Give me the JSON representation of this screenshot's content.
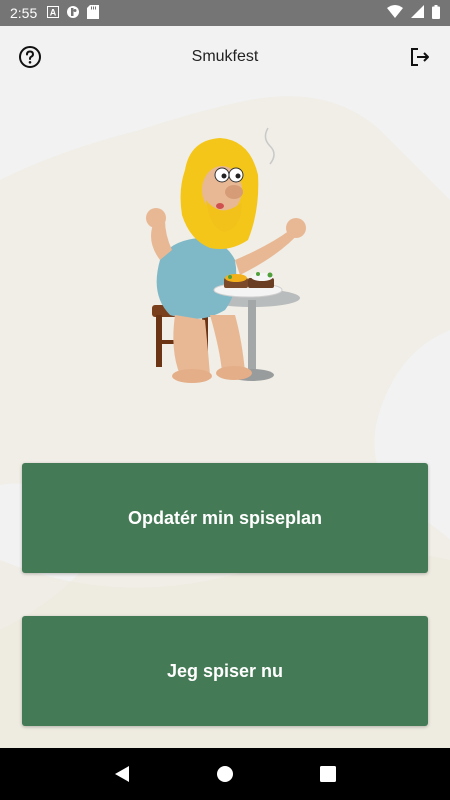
{
  "status_bar": {
    "time": "2:55",
    "icons": [
      "a-icon",
      "data-saver-icon",
      "sd-card-icon",
      "wifi-icon",
      "signal-icon",
      "battery-icon"
    ]
  },
  "app_bar": {
    "title": "Smukfest",
    "left_icon": "help-icon",
    "right_icon": "logout-icon"
  },
  "illustration": {
    "name": "mascot-eating-illustration"
  },
  "actions": {
    "update_plan": "Opdatér min spiseplan",
    "eat_now": "Jeg spiser nu"
  },
  "colors": {
    "button": "#447a55",
    "status_bar": "#757575",
    "background": "#f2f2f2"
  },
  "nav_bar": {
    "icons": [
      "back-icon",
      "home-icon",
      "recents-icon"
    ]
  }
}
